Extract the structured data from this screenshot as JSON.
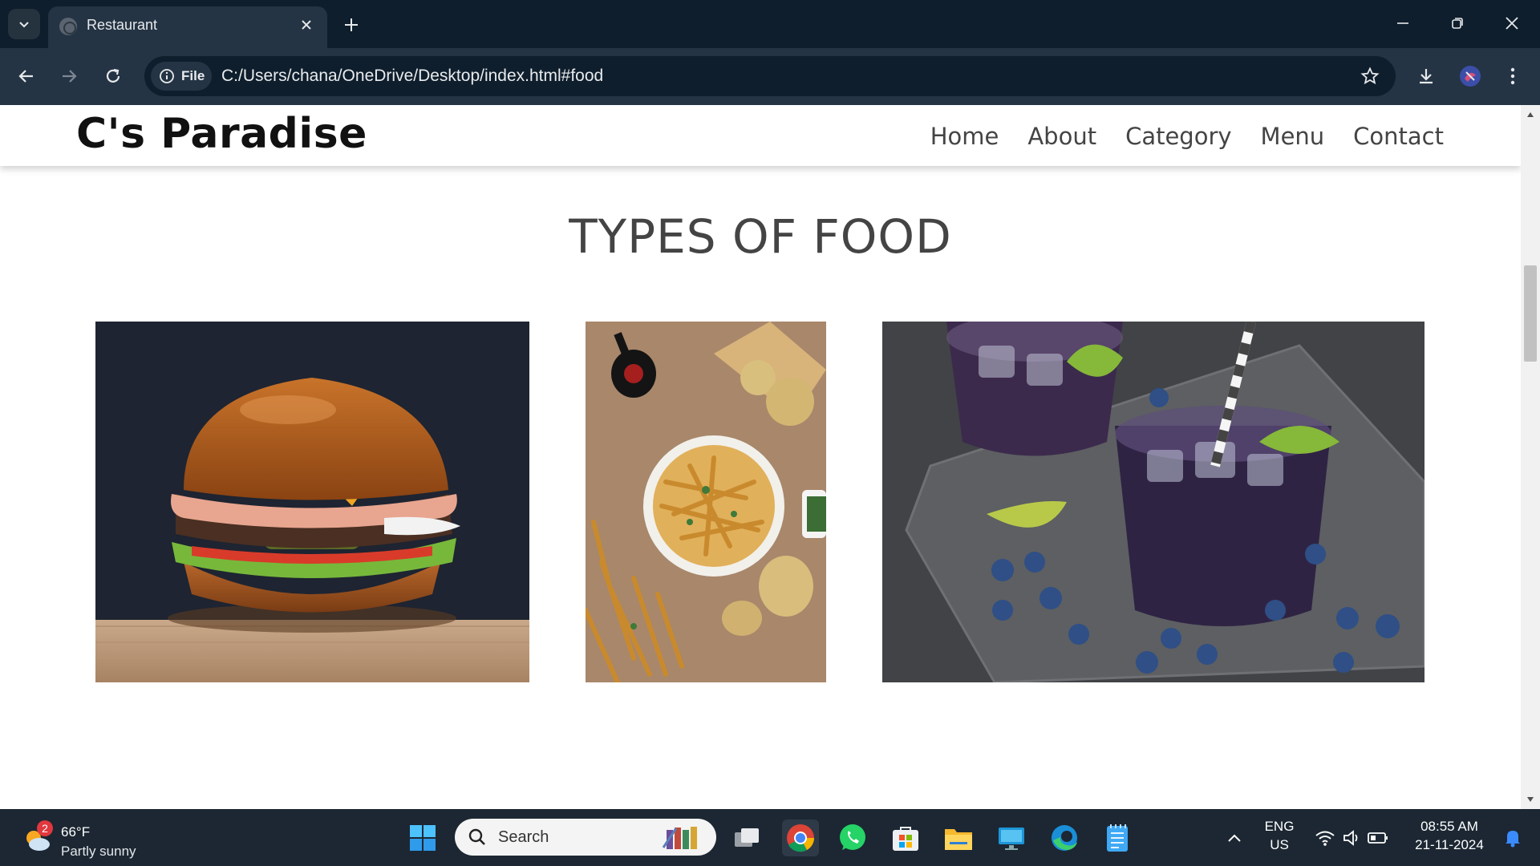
{
  "browser": {
    "tab_title": "Restaurant",
    "site_chip": "File",
    "url": "C:/Users/chana/OneDrive/Desktop/index.html#food"
  },
  "site": {
    "logo": "C's Paradise",
    "nav": [
      "Home",
      "About",
      "Category",
      "Menu",
      "Contact"
    ],
    "section_title": "TYPES OF FOOD",
    "images": [
      "burger",
      "french fries",
      "blueberry drinks"
    ]
  },
  "taskbar": {
    "weather_badge": "2",
    "temperature": "66°F",
    "condition": "Partly sunny",
    "search_placeholder": "Search",
    "lang_1": "ENG",
    "lang_2": "US",
    "time": "08:55 AM",
    "date": "21-11-2024"
  },
  "colors": {
    "chrome_dark": "#0f1e2c",
    "chrome_mid": "#243444",
    "taskbar": "#1c2733"
  }
}
